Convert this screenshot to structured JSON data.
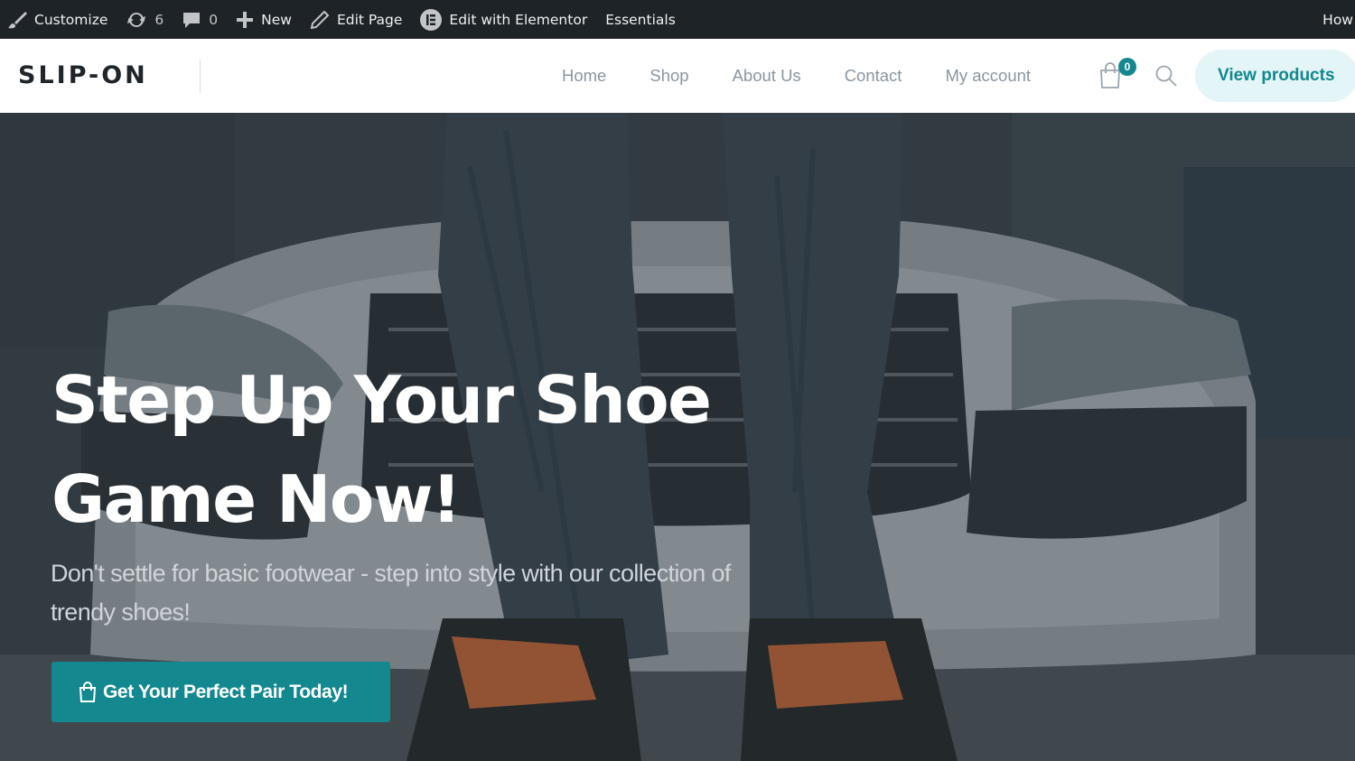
{
  "adminbar": {
    "customize_label": "Customize",
    "updates_count": "6",
    "comments_count": "0",
    "new_label": "New",
    "edit_page_label": "Edit Page",
    "elementor_label": "Edit with Elementor",
    "essentials_label": "Essentials",
    "howdy_label": "How"
  },
  "header": {
    "logo": "SLIP-ON",
    "nav": [
      "Home",
      "Shop",
      "About Us",
      "Contact",
      "My account"
    ],
    "cart_count": "0",
    "cta_label": "View products"
  },
  "hero": {
    "title_line1": "Step Up Your Shoe",
    "title_line2": "Game Now!",
    "subtitle_line1": "Don't settle for basic footwear - step into style with our collection of",
    "subtitle_line2": "trendy shoes!",
    "button_label": "Get Your Perfect Pair Today!"
  },
  "colors": {
    "accent": "#13888f",
    "admin_bar": "#1d2327",
    "nav_text": "#8a96a0",
    "cta_bg": "#e3f5f6"
  }
}
